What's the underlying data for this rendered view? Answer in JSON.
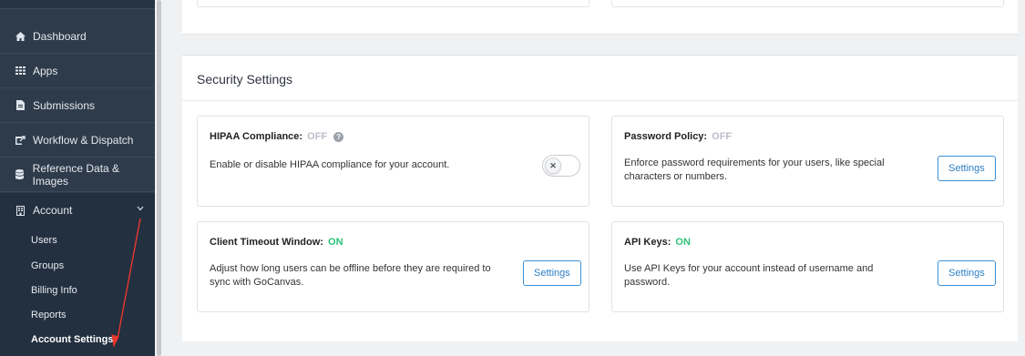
{
  "sidebar": {
    "items": [
      {
        "label": "Dashboard",
        "icon": "home-icon"
      },
      {
        "label": "Apps",
        "icon": "apps-grid-icon"
      },
      {
        "label": "Submissions",
        "icon": "document-icon"
      },
      {
        "label": "Workflow & Dispatch",
        "icon": "dispatch-icon"
      },
      {
        "label": "Reference Data & Images",
        "icon": "database-icon"
      },
      {
        "label": "Account",
        "icon": "building-icon",
        "expanded": true
      }
    ],
    "subitems": [
      {
        "label": "Users"
      },
      {
        "label": "Groups"
      },
      {
        "label": "Billing Info"
      },
      {
        "label": "Reports"
      },
      {
        "label": "Account Settings",
        "active": true
      }
    ]
  },
  "security": {
    "title": "Security Settings",
    "cards": {
      "hipaa": {
        "title": "HIPAA Compliance:",
        "status": "OFF",
        "description": "Enable or disable HIPAA compliance for your account.",
        "toggle_on": false
      },
      "password": {
        "title": "Password Policy:",
        "status": "OFF",
        "description_line1": "Enforce password requirements for your users, like special",
        "description_line2": "characters or numbers.",
        "button": "Settings"
      },
      "timeout": {
        "title": "Client Timeout Window:",
        "status": "ON",
        "description_line1": "Adjust how long users can be offline before they are required to",
        "description_line2": "sync with GoCanvas.",
        "button": "Settings"
      },
      "apikeys": {
        "title": "API Keys:",
        "status": "ON",
        "description_line1": "Use API Keys for your account instead of username and",
        "description_line2": "password.",
        "button": "Settings"
      }
    }
  },
  "colors": {
    "sidebar_bg": "#2e3b4a",
    "status_on": "#2fc27a",
    "status_off": "#b9bec6",
    "button_accent": "#3a8fd6",
    "annotation_arrow": "#e8372c"
  }
}
